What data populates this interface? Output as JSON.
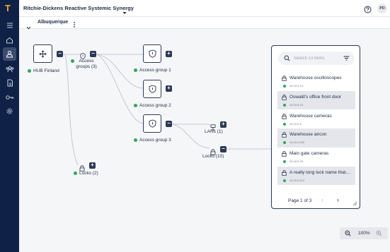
{
  "app": {
    "logo": "T",
    "title": "Ritchie-Dickens Reactive Systemic Synergy",
    "avatar_initials": "PO"
  },
  "sidebar": {
    "items": [
      {
        "icon": "menu-icon"
      },
      {
        "icon": "home-icon"
      },
      {
        "icon": "user-badge-icon",
        "active": true
      },
      {
        "icon": "users-icon"
      },
      {
        "icon": "document-icon"
      },
      {
        "icon": "key-icon"
      },
      {
        "icon": "gear-icon"
      }
    ]
  },
  "subheader": {
    "title": "Albuquerque"
  },
  "tree": {
    "hub": {
      "label": "HUB Finland"
    },
    "access_groups": {
      "label_line1": "Access",
      "label_line2": "groups (3)"
    },
    "groups": [
      {
        "label": "Access group 1"
      },
      {
        "label": "Access group 2"
      },
      {
        "label": "Access group 3"
      }
    ],
    "lans": {
      "label": "LANs (1)"
    },
    "locks_group3": {
      "label": "Locks (10)"
    },
    "locks_hub": {
      "label": "Locks (2)"
    }
  },
  "lock_panel": {
    "search_placeholder": "Search 13 items",
    "items": [
      {
        "name": "Warehouse oscilloscopes",
        "ip": "10.10.0.14"
      },
      {
        "name": "Oswald's office front door",
        "ip": "10.10.0.13"
      },
      {
        "name": "Warehouse cameras",
        "ip": "10.10.0.4"
      },
      {
        "name": "Warehouse aircon",
        "ip": "10.10.0.232"
      },
      {
        "name": "Main gate cameras",
        "ip": "10.10.0.76"
      },
      {
        "name": "A really long lock name that...",
        "ip": "10.10.0.213"
      }
    ],
    "pagination": "Page 1 of 3"
  },
  "zoom": {
    "value": "100%"
  },
  "colors": {
    "sidebar_bg": "#0f2147",
    "logo": "#f2a93b",
    "online": "#2ba85a",
    "node_border": "#2b3954",
    "connector": "#b7bcc7"
  }
}
